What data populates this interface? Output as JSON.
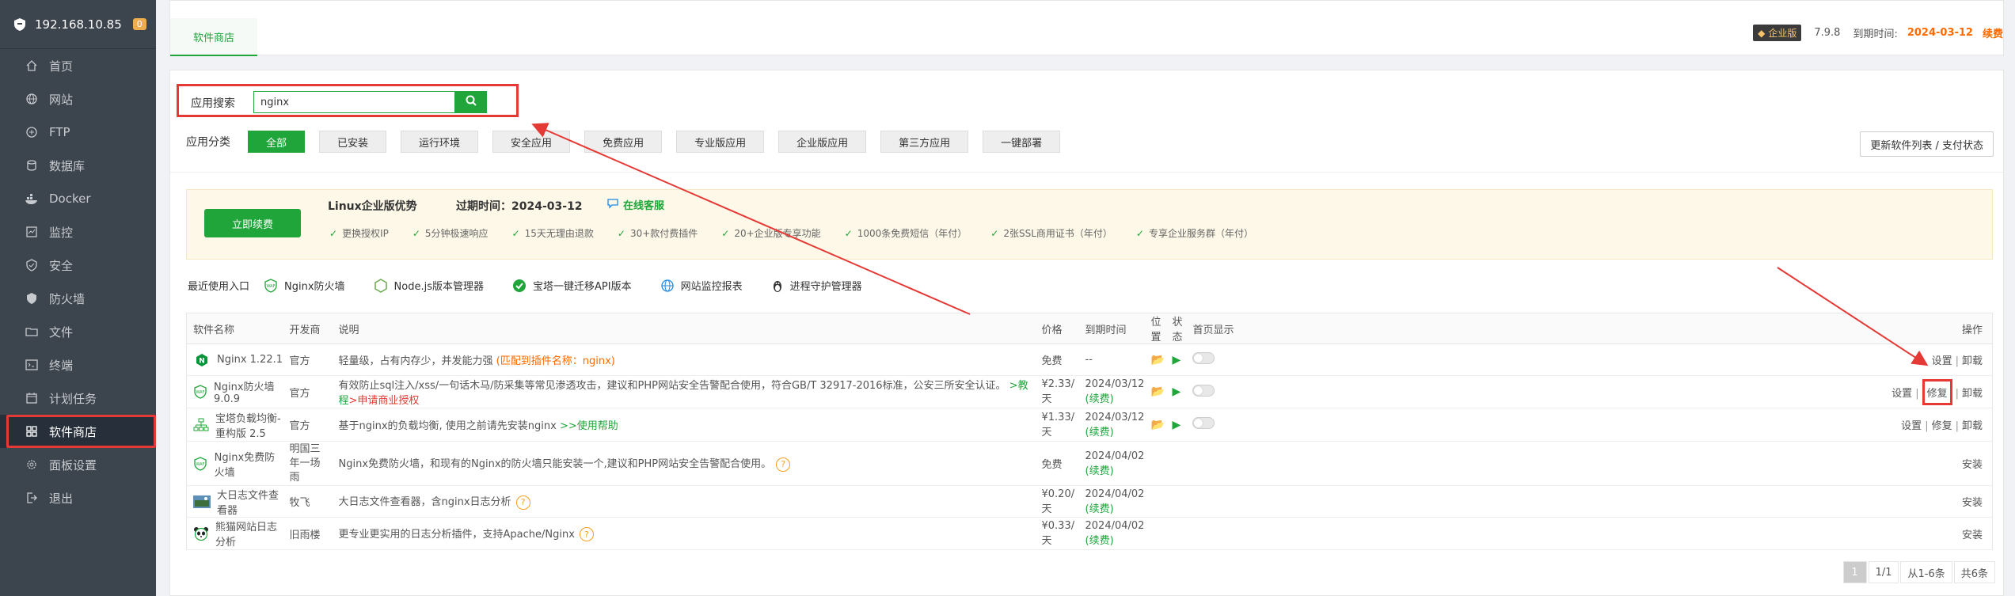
{
  "sidebar": {
    "host": "192.168.10.85",
    "badge": "0",
    "items": [
      {
        "label": "首页",
        "icon": "home-icon"
      },
      {
        "label": "网站",
        "icon": "globe-icon"
      },
      {
        "label": "FTP",
        "icon": "ftp-icon"
      },
      {
        "label": "数据库",
        "icon": "database-icon"
      },
      {
        "label": "Docker",
        "icon": "docker-icon"
      },
      {
        "label": "监控",
        "icon": "monitor-icon"
      },
      {
        "label": "安全",
        "icon": "shield-icon"
      },
      {
        "label": "防火墙",
        "icon": "firewall-icon"
      },
      {
        "label": "文件",
        "icon": "folder-icon"
      },
      {
        "label": "终端",
        "icon": "terminal-icon"
      },
      {
        "label": "计划任务",
        "icon": "calendar-icon"
      },
      {
        "label": "软件商店",
        "icon": "grid-icon",
        "active": true
      },
      {
        "label": "面板设置",
        "icon": "gear-icon"
      },
      {
        "label": "退出",
        "icon": "logout-icon"
      }
    ]
  },
  "topbar": {
    "tab": "软件商店",
    "edition": "企业版",
    "version": "7.9.8",
    "expire_label": "到期时间:",
    "expire_date": "2024-03-12",
    "renew": "续费"
  },
  "search": {
    "label": "应用搜索",
    "value": "nginx"
  },
  "categories": {
    "label": "应用分类",
    "items": [
      "全部",
      "已安装",
      "运行环境",
      "安全应用",
      "免费应用",
      "专业版应用",
      "企业版应用",
      "第三方应用",
      "一键部署"
    ],
    "active": "全部"
  },
  "update_button": "更新软件列表 / 支付状态",
  "promo": {
    "button": "立即续费",
    "title": "Linux企业版优势",
    "expire": "过期时间：2024-03-12",
    "service": "在线客服",
    "features": [
      "更换授权IP",
      "5分钟极速响应",
      "15天无理由退款",
      "30+款付费插件",
      "20+企业版专享功能",
      "1000条免费短信（年付）",
      "2张SSL商用证书（年付）",
      "专享企业服务群（年付）"
    ]
  },
  "recent": {
    "label": "最近使用入口",
    "items": [
      "Nginx防火墙",
      "Node.js版本管理器",
      "宝塔一键迁移API版本",
      "网站监控报表",
      "进程守护管理器"
    ]
  },
  "table": {
    "headers": [
      "软件名称",
      "开发商",
      "说明",
      "价格",
      "到期时间",
      "位置",
      "状态",
      "首页显示",
      "操作"
    ],
    "rows": [
      {
        "name": "Nginx 1.22.1",
        "vendor": "官方",
        "desc": "轻量级，占有内存少，并发能力强",
        "desc_extra": "(匹配到插件名称：nginx)",
        "price": "免费",
        "expire": "--",
        "ops": [
          "设置",
          "卸载"
        ]
      },
      {
        "name": "Nginx防火墙 9.0.9",
        "vendor": "官方",
        "desc": "有效防止sql注入/xss/一句话木马/防采集等常见渗透攻击，建议和PHP网站安全告警配合使用，符合GB/T 32917-2016标准，公安三所安全认证。",
        "desc_link1": ">教程",
        "desc_link2": ">申请商业授权",
        "price": "¥2.33/天",
        "expire": "2024/03/12",
        "expire_renew": "(续费)",
        "ops": [
          "设置",
          "修复",
          "卸载"
        ]
      },
      {
        "name": "宝塔负载均衡-重构版 2.5",
        "vendor": "官方",
        "desc": "基于nginx的负载均衡, 使用之前请先安装nginx",
        "desc_link1": ">>使用帮助",
        "price": "¥1.33/天",
        "expire": "2024/03/12",
        "expire_renew": "(续费)",
        "ops": [
          "设置",
          "修复",
          "卸载"
        ]
      },
      {
        "name": "Nginx免费防火墙",
        "vendor": "明国三年一场雨",
        "desc": "Nginx免费防火墙，和现有的Nginx的防火墙只能安装一个,建议和PHP网站安全告警配合使用。",
        "price": "免费",
        "expire": "2024/04/02",
        "expire_renew": "(续费)",
        "ops": [
          "安装"
        ]
      },
      {
        "name": "大日志文件查看器",
        "vendor": "牧飞",
        "desc": "大日志文件查看器，含nginx日志分析",
        "price": "¥0.20/天",
        "expire": "2024/04/02",
        "expire_renew": "(续费)",
        "ops": [
          "安装"
        ]
      },
      {
        "name": "熊猫网站日志分析",
        "vendor": "旧雨楼",
        "desc": "更专业更实用的日志分析插件，支持Apache/Nginx",
        "price": "¥0.33/天",
        "expire": "2024/04/02",
        "expire_renew": "(续费)",
        "ops": [
          "安装"
        ]
      }
    ]
  },
  "pager": {
    "current": "1",
    "pages": "1/1",
    "range": "从1-6条",
    "total": "共6条"
  },
  "colors": {
    "accent": "#20a53a",
    "sidebar": "#3c444d",
    "annotation": "#e53935",
    "price": "#ff6a00"
  }
}
